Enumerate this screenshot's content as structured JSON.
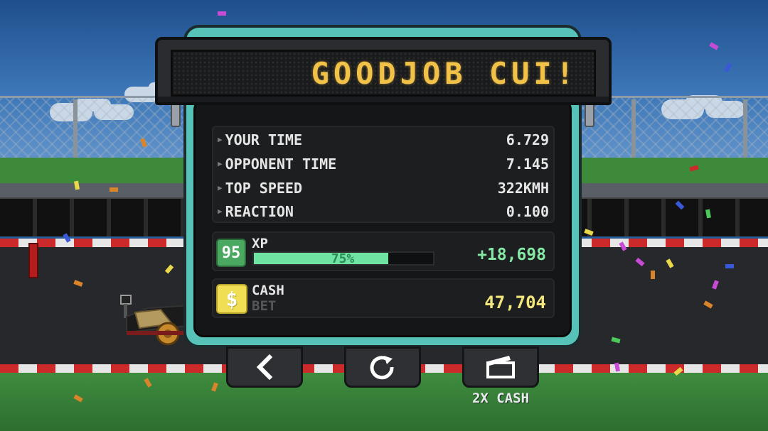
{
  "banner": {
    "text": "GOODJOB CUI!"
  },
  "stats": [
    {
      "label": "YOUR TIME",
      "value": "6.729"
    },
    {
      "label": "OPPONENT TIME",
      "value": "7.145"
    },
    {
      "label": "TOP SPEED",
      "value": "322KMH"
    },
    {
      "label": "REACTION",
      "value": "0.100"
    }
  ],
  "xp": {
    "level": "95",
    "label": "XP",
    "progress_percent": 75,
    "progress_text": "75%",
    "gain": "+18,698",
    "bar_color": "#6ee3a2"
  },
  "cash": {
    "icon": "dollar-icon",
    "label": "CASH",
    "sub_label": "BET",
    "value": "47,704"
  },
  "buttons": {
    "back_icon": "chevron-left-icon",
    "replay_icon": "replay-icon",
    "double_cash_icon": "clapper-icon",
    "double_cash_caption": "2X CASH"
  },
  "colors": {
    "panel_teal": "#57c3b8",
    "banner_text": "#f2c248",
    "xp_gain": "#86e8a5",
    "cash_value": "#f3e77c"
  }
}
